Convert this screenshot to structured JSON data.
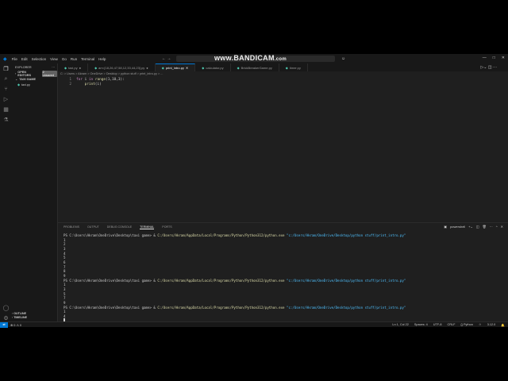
{
  "menu": [
    "File",
    "Edit",
    "Selection",
    "View",
    "Go",
    "Run",
    "Terminal",
    "Help"
  ],
  "watermark": {
    "main": "www.BANDICAM",
    "suffix": ".com"
  },
  "window_controls": [
    "—",
    "□",
    "✕"
  ],
  "sidebar": {
    "title": "EXPLORER",
    "open_editors": "OPEN EDITORS",
    "unsaved": "2 unsaved",
    "folder": "TAXI GAME",
    "files": [
      "taxi.py"
    ],
    "outline": "OUTLINE",
    "timeline": "TIMELINE"
  },
  "tabs": [
    {
      "label": "taxi.py",
      "modified": true
    },
    {
      "label": "arr=[18,26,47,58,12,33,44,23].py",
      "modified": true
    },
    {
      "label": "print_intro.py",
      "active": true
    },
    {
      "label": "calculator.py"
    },
    {
      "label": "BrickBreakerGame.py"
    },
    {
      "label": "timer.py"
    }
  ],
  "breadcrumb": "C: > Users > Akram > OneDrive > Desktop > python stuff > print_intro.py > ...",
  "code": {
    "line1": {
      "n": "1",
      "kw": "for",
      "rest1": " i ",
      "kw2": "in",
      "fn": " range",
      "args": "(1,10,3):"
    },
    "line2": {
      "n": "2",
      "fn": "print",
      "args": "(i)"
    }
  },
  "panel_tabs": [
    "PROBLEMS",
    "OUTPUT",
    "DEBUG CONSOLE",
    "TERMINAL",
    "PORTS"
  ],
  "terminal_name": "powershell",
  "terminal": {
    "prompt": "PS C:\\Users\\Akram\\OneDrive\\Desktop\\taxi game> & ",
    "exe": "C:/Users/Akram/AppData/Local/Programs/Python/Python312/python.exe",
    "script": " \"c:/Users/Akram/OneDrive/Desktop/python stuff/print_intro.py\"",
    "run1": "1\n2\n3\n4\n5\n6\n7\n8\n9",
    "run2": "1\n3\n5\n7\n9",
    "run3": "1\n4"
  },
  "status": {
    "errors": "⊗ 0 ⚠ 0",
    "position": "Ln 1, Col 22",
    "spaces": "Spaces: 4",
    "encoding": "UTF-8",
    "eol": "CRLF",
    "language": "{} Python",
    "version": "3.12.0"
  }
}
